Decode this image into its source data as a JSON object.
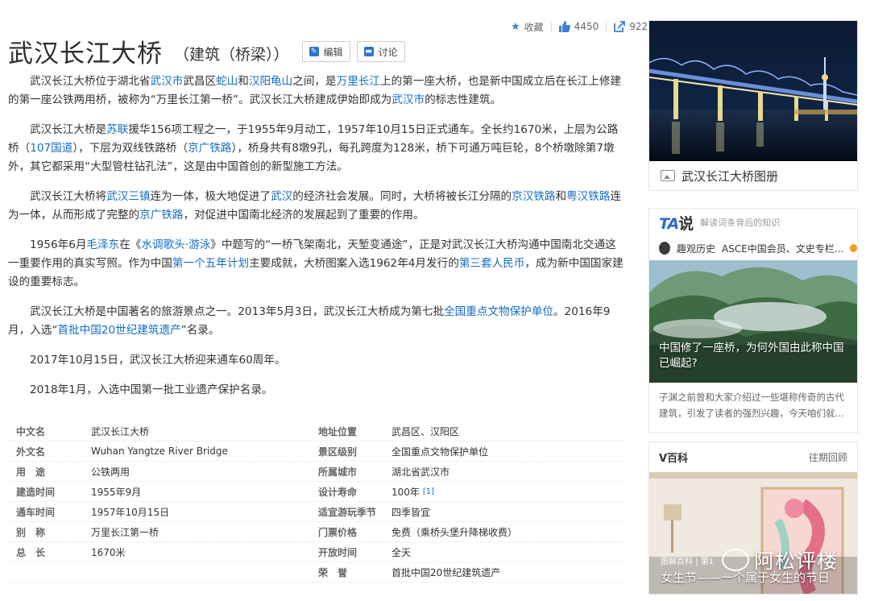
{
  "actions": {
    "collect": "收藏",
    "likes": "4450",
    "shares": "922"
  },
  "title": {
    "main": "武汉长江大桥",
    "sub": "（建筑（桥梁））",
    "edit": "编辑",
    "discuss": "讨论"
  },
  "paragraphs": [
    [
      {
        "t": "武汉长江大桥位于湖北省"
      },
      {
        "t": "武汉市",
        "link": true
      },
      {
        "t": "武昌区"
      },
      {
        "t": "蛇山",
        "link": true
      },
      {
        "t": "和"
      },
      {
        "t": "汉阳龟山",
        "link": true
      },
      {
        "t": "之间，是"
      },
      {
        "t": "万里长江",
        "link": true
      },
      {
        "t": "上的第一座大桥，也是新中国成立后在长江上修建的第一座公铁两用桥，被称为“万里长江第一桥”。武汉长江大桥建成伊始即成为"
      },
      {
        "t": "武汉市",
        "link": true
      },
      {
        "t": "的标志性建筑。"
      }
    ],
    [
      {
        "t": "武汉长江大桥是"
      },
      {
        "t": "苏联",
        "link": true
      },
      {
        "t": "援华156项工程之一，于1955年9月动工，1957年10月15日正式通车。全长约1670米，上层为公路桥（"
      },
      {
        "t": "107国道",
        "link": true
      },
      {
        "t": "），下层为双线铁路桥（"
      },
      {
        "t": "京广铁路",
        "link": true
      },
      {
        "t": "），桥身共有8墩9孔，每孔跨度为128米，桥下可通万吨巨轮，8个桥墩除第7墩外，其它都采用“大型管柱钻孔法”，这是由中国首创的新型施工方法。"
      }
    ],
    [
      {
        "t": "武汉长江大桥将"
      },
      {
        "t": "武汉三镇",
        "link": true
      },
      {
        "t": "连为一体，极大地促进了"
      },
      {
        "t": "武汉",
        "link": true
      },
      {
        "t": "的经济社会发展。同时，大桥将被长江分隔的"
      },
      {
        "t": "京汉铁路",
        "link": true
      },
      {
        "t": "和"
      },
      {
        "t": "粤汉铁路",
        "link": true
      },
      {
        "t": "连为一体，从而形成了完整的"
      },
      {
        "t": "京广铁路",
        "link": true
      },
      {
        "t": "，对促进中国南北经济的发展起到了重要的作用。"
      }
    ],
    [
      {
        "t": "1956年6月"
      },
      {
        "t": "毛泽东",
        "link": true
      },
      {
        "t": "在《"
      },
      {
        "t": "水调歌头·游泳",
        "link": true
      },
      {
        "t": "》中题写的“一桥飞架南北，天堑变通途”，正是对武汉长江大桥沟通中国南北交通这一重要作用的真实写照。作为中国"
      },
      {
        "t": "第一个五年计划",
        "link": true
      },
      {
        "t": "主要成就，大桥图案入选1962年4月发行的"
      },
      {
        "t": "第三套人民币",
        "link": true
      },
      {
        "t": "，成为新中国国家建设的重要标志。"
      }
    ],
    [
      {
        "t": "武汉长江大桥是中国著名的旅游景点之一。2013年5月3日，武汉长江大桥成为第七批"
      },
      {
        "t": "全国重点文物保护单位",
        "link": true
      },
      {
        "t": "。2016年9月，入选“"
      },
      {
        "t": "首批中国20世纪建筑遗产",
        "link": true
      },
      {
        "t": "”名录。"
      }
    ],
    [
      {
        "t": "2017年10月15日，武汉长江大桥迎来通车60周年。"
      }
    ],
    [
      {
        "t": "2018年1月，入选中国第一批工业遗产保护名录。"
      }
    ]
  ],
  "infobox": [
    {
      "k": "中文名",
      "v": "武汉长江大桥",
      "k2": "地址位置",
      "v2": "武昌区、汉阳区",
      "v2link": false
    },
    {
      "k": "外文名",
      "v": "Wuhan Yangtze River Bridge",
      "k2": "景区级别",
      "v2": "全国重点文物保护单位",
      "v2link": true
    },
    {
      "k": "用　途",
      "v": "公铁两用",
      "k2": "所属城市",
      "v2": "湖北省武汉市",
      "v2link": true
    },
    {
      "k": "建造时间",
      "v": "1955年9月",
      "k2": "设计寿命",
      "v2": "100年",
      "v2link": false,
      "sup": "[1]"
    },
    {
      "k": "通车时间",
      "v": "1957年10月15日",
      "k2": "适宜游玩季节",
      "v2": "四季皆宜",
      "v2link": false
    },
    {
      "k": "别　称",
      "v": "万里长江第一桥",
      "k2": "门票价格",
      "v2": "免费（乘桥头堡升降梯收费）",
      "v2link": false
    },
    {
      "k": "总　长",
      "v": "1670米",
      "k2": "开放时间",
      "v2": "全天",
      "v2link": false
    },
    {
      "k": "",
      "v": "",
      "k2": "荣　誉",
      "v2": "首批中国20世纪建筑遗产",
      "v2link": true
    }
  ],
  "album": {
    "caption": "武汉长江大桥图册"
  },
  "ta": {
    "logo": "TA",
    "logo_suffix": "说",
    "slogan": "解读词条背后的知识",
    "author": "趣观历史",
    "author_desc": "ASCE中国会员、文史专栏...",
    "headline": "中国修了一座桥，为何外国由此称中国已崛起?",
    "desc": "子渊之前曾和大家介绍过一些堪称传奇的古代建筑，引发了读者的强烈兴趣，今天咱们就..."
  },
  "vbaike": {
    "title": "V百科",
    "more": "往期回顾",
    "tag": "图解百科 | 第1",
    "caption": "女生节——一个属于女生的节日"
  },
  "watermark": "阿松评楼"
}
